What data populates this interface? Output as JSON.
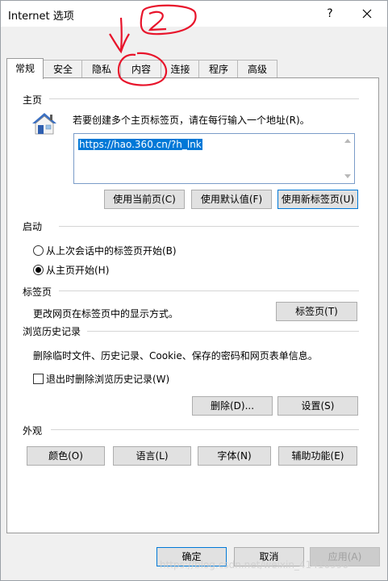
{
  "window": {
    "title": "Internet 选项",
    "help": "?",
    "close_icon": "close-icon"
  },
  "tabs": [
    {
      "label": "常规",
      "active": true
    },
    {
      "label": "安全"
    },
    {
      "label": "隐私"
    },
    {
      "label": "内容"
    },
    {
      "label": "连接"
    },
    {
      "label": "程序"
    },
    {
      "label": "高级"
    }
  ],
  "homepage": {
    "group_label": "主页",
    "description": "若要创建多个主页标签页，请在每行输入一个地址(R)。",
    "url": "https://hao.360.cn/?h_lnk",
    "buttons": {
      "use_current": "使用当前页(C)",
      "use_default": "使用默认值(F)",
      "use_new_tab": "使用新标签页(U)"
    }
  },
  "startup": {
    "group_label": "启动",
    "option_last_session": "从上次会话中的标签页开始(B)",
    "option_homepage": "从主页开始(H)",
    "selected": "homepage"
  },
  "tabs_section": {
    "group_label": "标签页",
    "description": "更改网页在标签页中的显示方式。",
    "button": "标签页(T)"
  },
  "history": {
    "group_label": "浏览历史记录",
    "description": "删除临时文件、历史记录、Cookie、保存的密码和网页表单信息。",
    "checkbox_label": "退出时删除浏览历史记录(W)",
    "checked": false,
    "delete_button": "删除(D)...",
    "settings_button": "设置(S)"
  },
  "appearance": {
    "group_label": "外观",
    "colors": "颜色(O)",
    "languages": "语言(L)",
    "fonts": "字体(N)",
    "accessibility": "辅助功能(E)"
  },
  "footer": {
    "ok": "确定",
    "cancel": "取消",
    "apply": "应用(A)"
  },
  "watermark": "https://blog.csdn.net/weixin_41416996",
  "annotation": {
    "number": "2",
    "color": "#e8142b"
  }
}
